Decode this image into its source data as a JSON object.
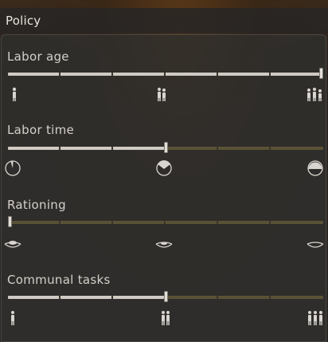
{
  "window": {
    "title": "Policy"
  },
  "policies": [
    {
      "key": "labor_age",
      "label": "Labor age",
      "value": 1.0,
      "steps": 6,
      "icons": [
        "child-icon",
        "two-people-icon",
        "three-people-icon"
      ]
    },
    {
      "key": "labor_time",
      "label": "Labor time",
      "value": 0.5,
      "steps": 6,
      "icons": [
        "dial-small-icon",
        "dial-half-icon",
        "dial-full-icon"
      ]
    },
    {
      "key": "rationing",
      "label": "Rationing",
      "value": 0.0,
      "steps": 6,
      "icons": [
        "food-bowl-full-icon",
        "food-bowl-half-icon",
        "food-bowl-empty-icon"
      ]
    },
    {
      "key": "communal_tasks",
      "label": "Communal tasks",
      "value": 0.5,
      "steps": 6,
      "icons": [
        "one-worker-icon",
        "two-workers-icon",
        "three-workers-icon"
      ]
    }
  ],
  "colors": {
    "fill": "#cfcbc4",
    "track": "#5a5236",
    "accent": "#e2ded8"
  }
}
